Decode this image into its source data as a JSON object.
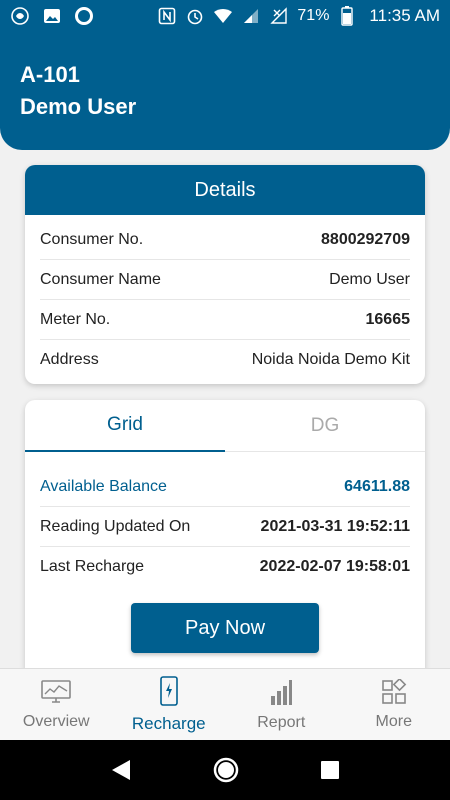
{
  "status_bar": {
    "battery": "71%",
    "time": "11:35 AM"
  },
  "header": {
    "unit": "A-101",
    "user": "Demo User"
  },
  "details": {
    "title": "Details",
    "rows": [
      {
        "label": "Consumer No.",
        "value": "8800292709"
      },
      {
        "label": "Consumer Name",
        "value": "Demo User"
      },
      {
        "label": "Meter No.",
        "value": "16665"
      },
      {
        "label": "Address",
        "value": "Noida Noida Demo Kit"
      }
    ]
  },
  "balance": {
    "tabs": [
      {
        "label": "Grid",
        "active": true
      },
      {
        "label": "DG",
        "active": false
      }
    ],
    "rows": [
      {
        "label": "Available Balance",
        "value": "64611.88"
      },
      {
        "label": "Reading Updated On",
        "value": "2021-03-31 19:52:11"
      },
      {
        "label": "Last Recharge",
        "value": "2022-02-07 19:58:01"
      }
    ],
    "pay_button": "Pay Now"
  },
  "bottom_nav": [
    {
      "label": "Overview",
      "icon": "monitor-icon"
    },
    {
      "label": "Recharge",
      "icon": "phone-charge-icon",
      "active": true
    },
    {
      "label": "Report",
      "icon": "bar-chart-icon"
    },
    {
      "label": "More",
      "icon": "grid-shapes-icon"
    }
  ],
  "colors": {
    "primary": "#005f8f",
    "inactive": "#777777"
  }
}
